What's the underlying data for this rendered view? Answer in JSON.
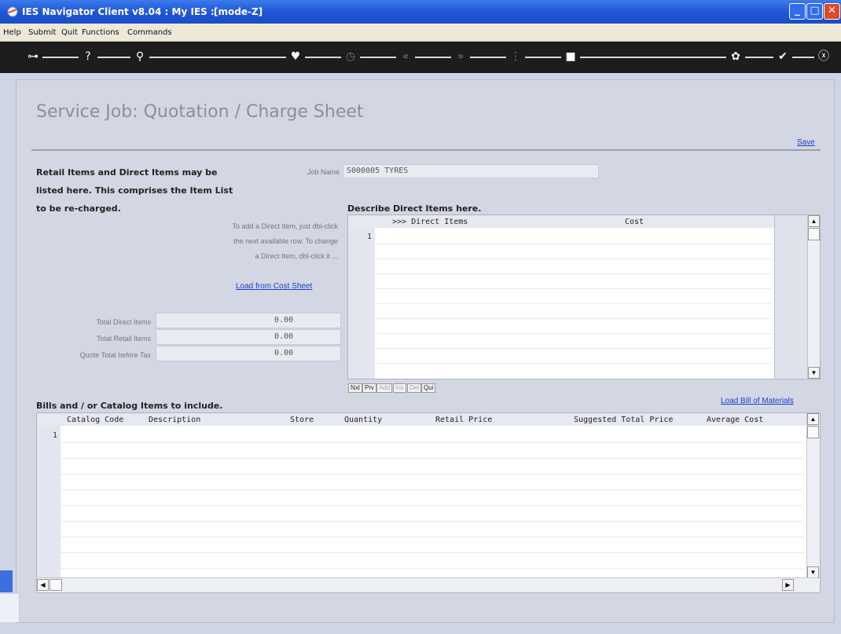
{
  "window": {
    "title": "IES Navigator Client v8.04 : My IES :",
    "mode": "[mode-Z]"
  },
  "menu": [
    "Help",
    "Submit",
    "Quit",
    "Functions",
    "Commands"
  ],
  "toolbar": {
    "icons": [
      "key-icon",
      "help-icon",
      "search-icon",
      "heart-icon",
      "clock-icon",
      "rewind-icon",
      "forward-icon",
      "list-icon",
      "stop-icon",
      "settings-icon",
      "check-icon",
      "close-icon"
    ]
  },
  "page": {
    "title": "Service Job: Quotation / Charge Sheet",
    "save_label": "Save"
  },
  "intro": {
    "line1": "Retail Items and Direct Items may be",
    "line2": "listed here. This comprises the Item List",
    "line3": "to be re-charged."
  },
  "job": {
    "label": "Job Name",
    "value": "S000005 TYRES"
  },
  "direct": {
    "heading": "Describe Direct Items here.",
    "hint1": "To add a Direct Item, just dbl-click",
    "hint2": "the next available row. To change",
    "hint3": "a Direct Item, dbl-click it ...",
    "load_link": "Load from Cost Sheet",
    "col_items": ">>> Direct Items",
    "col_cost": "Cost",
    "row1": "1",
    "nav": [
      "Nxt",
      "Prv",
      "Add",
      "Ins",
      "Del",
      "Qui"
    ]
  },
  "totals": {
    "direct_label": "Total Direct Items",
    "direct_value": "0.00",
    "retail_label": "Total Retail Items",
    "retail_value": "0.00",
    "quote_label": "Quote Total before Tax",
    "quote_value": "0.00"
  },
  "catalog": {
    "heading": "Bills and / or Catalog Items to include.",
    "load_link": "Load Bill of Materials",
    "columns": [
      "Catalog Code",
      "Description",
      "Store",
      "Quantity",
      "Retail Price",
      "Suggested Total Price",
      "Average Cost"
    ],
    "row1": "1"
  }
}
